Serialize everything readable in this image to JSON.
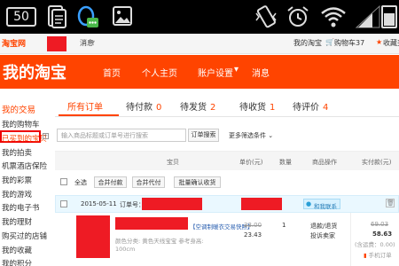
{
  "statusbar": {
    "badge": "50"
  },
  "topbar": {
    "logo": "淘宝网",
    "messages": "消息",
    "my_taobao": "我的淘宝",
    "cart": "购物车37",
    "favorites": "收藏夹"
  },
  "header": {
    "brand": "我的淘宝",
    "nav": [
      "首页",
      "个人主页",
      "账户设置",
      "消息"
    ]
  },
  "sidebar": {
    "title": "我的交易",
    "items": [
      "我的购物车",
      "已买到的宝贝",
      "我的拍卖",
      "机票酒店保险",
      "我的彩票",
      "我的游戏",
      "我的电子书",
      "我的理财",
      "购买过的店铺",
      "我的收藏",
      "我的积分"
    ]
  },
  "tabs": [
    {
      "label": "所有订单",
      "count": ""
    },
    {
      "label": "待付款",
      "count": "0"
    },
    {
      "label": "待发货",
      "count": "2"
    },
    {
      "label": "待收货",
      "count": "1"
    },
    {
      "label": "待评价",
      "count": "4"
    }
  ],
  "search": {
    "placeholder": "输入商品标题或订单号进行搜索",
    "button": "订单搜索",
    "more": "更多筛选条件 ⌄"
  },
  "columns": [
    "宝贝",
    "单价(元)",
    "数量",
    "商品操作",
    "实付款(元)"
  ],
  "actions": {
    "select_all": "全选",
    "merge_pay": "合并付款",
    "merge_proxy": "合并代付",
    "batch_confirm": "批量确认收货"
  },
  "order": {
    "date": "2015-05-11",
    "order_no_label": "订单号：",
    "contact": "和我联系",
    "title_fragment": "【空调制暖衣交易快照】",
    "spec": "颜色分类: 黄色天线宝宝  参考身高: 100cm",
    "price_orig": "33.00",
    "price_now": "23.43",
    "qty": "1",
    "op1": "退款/退货",
    "op2": "投诉卖家",
    "paid_orig": "69.03",
    "paid": "58.63",
    "shipping": "(含运费：0.00)",
    "phone_order": "手机订单"
  }
}
